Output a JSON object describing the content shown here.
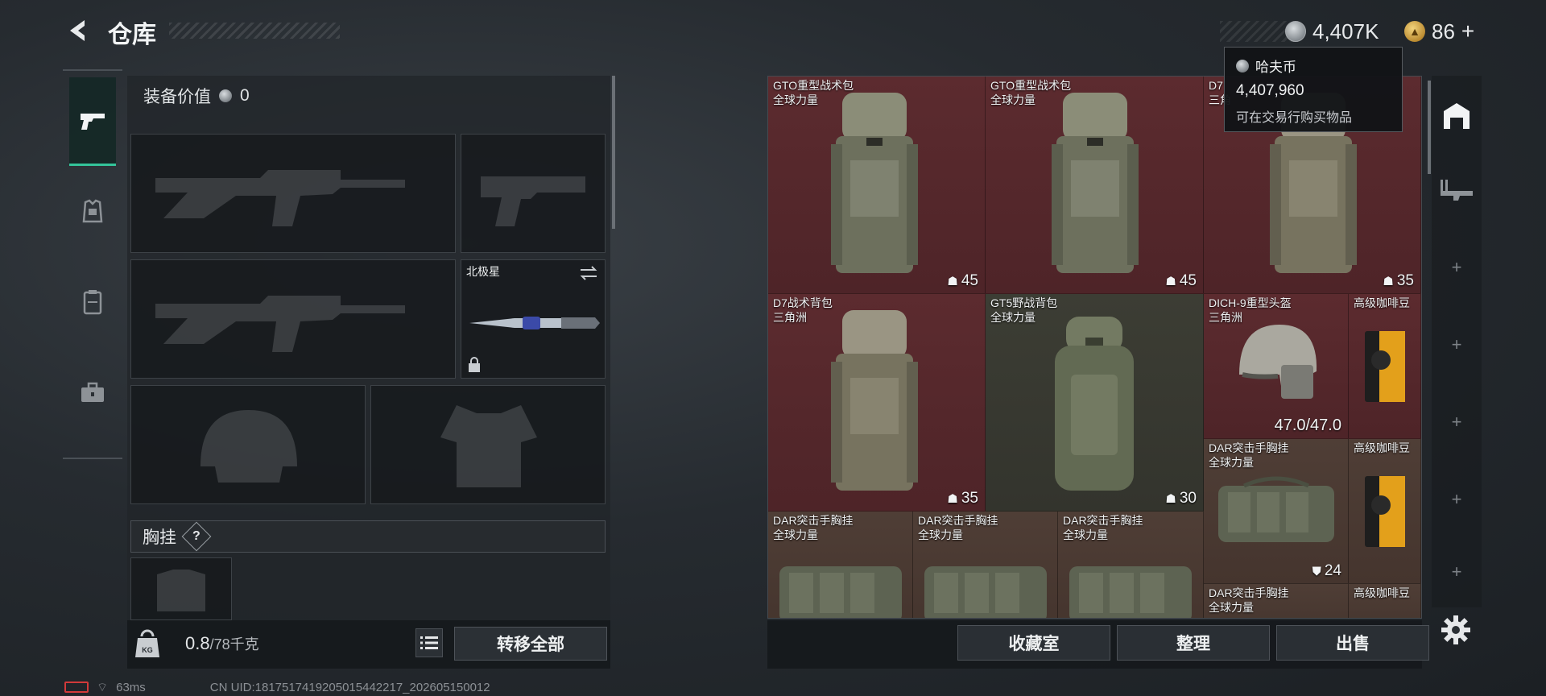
{
  "header": {
    "title": "仓库"
  },
  "currency": {
    "coins": "4,407K",
    "tokens": "86",
    "tokens_plus": "+"
  },
  "tooltip": {
    "name": "哈夫币",
    "amount": "4,407,960",
    "desc": "可在交易行购买物品"
  },
  "equip": {
    "value_label": "装备价值",
    "value": "0",
    "melee_name": "北极星",
    "section_label": "胸挂",
    "question": "?",
    "weight": "0.8",
    "weight_cap": "/78千克",
    "transfer_label": "转移全部"
  },
  "stash": {
    "items": [
      {
        "name": "GTO重型战术包",
        "sub": "全球力量",
        "count": "45"
      },
      {
        "name": "GTO重型战术包",
        "sub": "全球力量",
        "count": "45"
      },
      {
        "name": "D7",
        "sub": "三角",
        "count": "35"
      },
      {
        "name": "D7战术背包",
        "sub": "三角洲",
        "count": "35"
      },
      {
        "name": "GT5野战背包",
        "sub": "全球力量",
        "count": "30"
      },
      {
        "name": "DICH-9重型头盔",
        "sub": "三角洲",
        "count": "47.0/47.0"
      },
      {
        "name": "高级咖啡豆",
        "sub": "",
        "count": ""
      },
      {
        "name": "DAR突击手胸挂",
        "sub": "全球力量",
        "count": "24"
      },
      {
        "name": "高级咖啡豆",
        "sub": "",
        "count": ""
      },
      {
        "name": "DAR突击手胸挂",
        "sub": "全球力量",
        "count": ""
      },
      {
        "name": "DAR突击手胸挂",
        "sub": "全球力量",
        "count": ""
      },
      {
        "name": "DAR突击手胸挂",
        "sub": "全球力量",
        "count": ""
      },
      {
        "name": "DAR突击手胸挂",
        "sub": "全球力量",
        "count": ""
      },
      {
        "name": "高级咖啡豆",
        "sub": "",
        "count": ""
      }
    ],
    "btn_collection": "收藏室",
    "btn_sort": "整理",
    "btn_sell": "出售"
  },
  "status": {
    "ping": "63ms",
    "uid": "CN UID:1817517419205015442217_202605150012"
  },
  "colors": {
    "accent": "#34c49a",
    "rare_red": "#5c2b2f",
    "panel": "#22262a"
  }
}
